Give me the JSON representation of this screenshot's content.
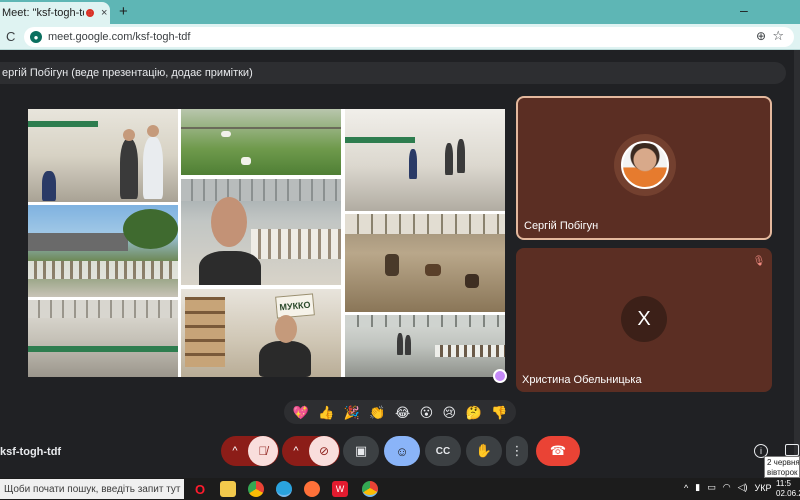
{
  "browser": {
    "tab_title": "Meet: \"ksf-togh-tdf\"",
    "tab_close": "×",
    "new_tab": "+",
    "window_minimize": "–",
    "reload": "C",
    "url": "meet.google.com/ksf-togh-tdf",
    "zoom": "⊕",
    "bookmark": "☆"
  },
  "meet": {
    "presenter_banner": "ергій Побігун (веде презентацію, додає примітки)",
    "presentation_sign": "МУККО",
    "participants": [
      {
        "name": "Сергій Побігун",
        "avatar": "photo"
      },
      {
        "name": "Христина Обельницька",
        "avatar_letter": "X",
        "muted": true
      }
    ],
    "reactions": [
      "💖",
      "👍",
      "🎉",
      "👏",
      "😂",
      "😮",
      "😢",
      "🤔",
      "👎"
    ],
    "meeting_code": "ksf-togh-tdf",
    "controls": {
      "chevron": "^",
      "mic_off": "🎙̸",
      "camera_off": "⊘",
      "present": "▣",
      "emoji": "☺",
      "captions": "CC",
      "raise_hand": "✋",
      "more": "⋮",
      "end_call": "☎",
      "info": "i"
    },
    "date_tooltip": [
      "2 червня",
      "вівторок"
    ]
  },
  "taskbar": {
    "search_placeholder": "Щоби почати пошук, введіть запит тут",
    "language": "УКР",
    "time": "11:5",
    "date": "02.06.2"
  },
  "colors": {
    "tab_strip": "#5eb6b5",
    "tile_background": "#5b2e23",
    "end_call": "#ea4335",
    "emoji_active": "#8ab4f8"
  }
}
